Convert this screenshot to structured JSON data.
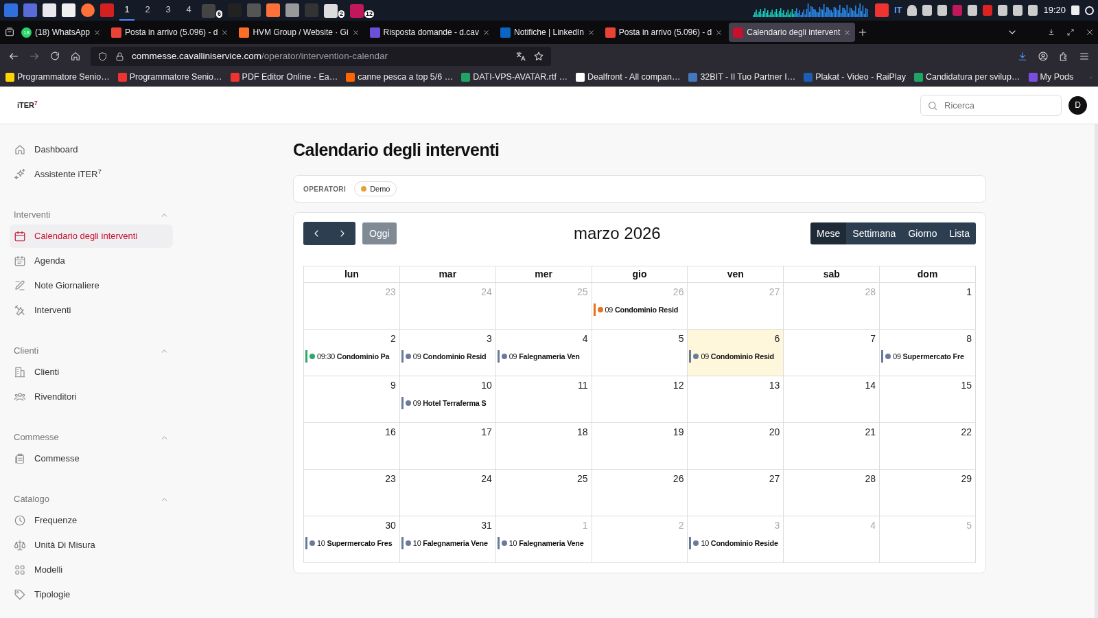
{
  "taskbar": {
    "workspaces": [
      {
        "label": "1",
        "selected": true
      },
      {
        "label": "2",
        "selected": false
      },
      {
        "label": "3",
        "selected": false
      },
      {
        "label": "4",
        "selected": false
      }
    ],
    "app_badges": [
      "6",
      "2",
      "12"
    ],
    "keyboard_layout": "IT",
    "clock": "19:20"
  },
  "browser": {
    "tabs": [
      {
        "title": "(18) WhatsApp",
        "badge": "18",
        "selected": false
      },
      {
        "title": "Posta in arrivo (5.096) - d",
        "selected": false
      },
      {
        "title": "HVM Group / Website · Gi",
        "selected": false
      },
      {
        "title": "Risposta domande - d.cav",
        "selected": false
      },
      {
        "title": "Notifiche | LinkedIn",
        "selected": false
      },
      {
        "title": "Posta in arrivo (5.096) - d",
        "selected": false
      },
      {
        "title": "Calendario degli intervent",
        "selected": true
      }
    ],
    "url_host": "commesse.cavalliniservice.com",
    "url_path": "/operator/intervention-calendar",
    "bookmarks": [
      "Programmatore Senio…",
      "Programmatore Senio…",
      "PDF Editor Online - Ea…",
      "canne pesca a top 5/6 …",
      "DATI-VPS-AVATAR.rtf …",
      "Dealfront - All compan…",
      "32BIT - Il Tuo Partner I…",
      "Plakat - Video - RaiPlay",
      "Candidatura per svilup…",
      "My Pods"
    ]
  },
  "app": {
    "logo": "iTER",
    "logo_sup": "7",
    "search": {
      "placeholder": "Ricerca"
    },
    "avatar": "D"
  },
  "sidebar": {
    "top_items": [
      {
        "label": "Dashboard",
        "selected": false
      },
      {
        "label": "Assistente iTER$^{7}$",
        "selected": false
      }
    ],
    "sections": [
      {
        "title": "Interventi",
        "expanded": true,
        "items": [
          {
            "label": "Calendario degli interventi",
            "selected": true
          },
          {
            "label": "Agenda",
            "selected": false
          },
          {
            "label": "Note Giornaliere",
            "selected": false
          },
          {
            "label": "Interventi",
            "selected": false
          }
        ]
      },
      {
        "title": "Clienti",
        "expanded": true,
        "items": [
          {
            "label": "Clienti",
            "selected": false
          },
          {
            "label": "Rivenditori",
            "selected": false
          }
        ]
      },
      {
        "title": "Commesse",
        "expanded": true,
        "items": [
          {
            "label": "Commesse",
            "selected": false
          }
        ]
      },
      {
        "title": "Catalogo",
        "expanded": true,
        "items": [
          {
            "label": "Frequenze",
            "selected": false
          },
          {
            "label": "Unità Di Misura",
            "selected": false
          },
          {
            "label": "Modelli",
            "selected": false
          },
          {
            "label": "Tipologie",
            "selected": false
          }
        ]
      }
    ]
  },
  "page_title": "Calendario degli interventi",
  "operators": {
    "label": "OPERATORI",
    "chips": [
      {
        "name": "Demo",
        "color": "#e5a23a"
      }
    ]
  },
  "calendar": {
    "today_button": "Oggi",
    "title": "marzo 2026",
    "views": [
      {
        "label": "Mese",
        "selected": true
      },
      {
        "label": "Settimana",
        "selected": false
      },
      {
        "label": "Giorno",
        "selected": false
      },
      {
        "label": "Lista",
        "selected": false
      }
    ],
    "weekdays": [
      "lun",
      "mar",
      "mer",
      "gio",
      "ven",
      "sab",
      "dom"
    ],
    "weeks": [
      [
        {
          "day": "23",
          "other_month": true,
          "today": false
        },
        {
          "day": "24",
          "other_month": true,
          "today": false
        },
        {
          "day": "25",
          "other_month": true,
          "today": false
        },
        {
          "day": "26",
          "other_month": true,
          "today": false,
          "events": [
            {
              "time": "09",
              "title": "Condominio Resid",
              "color": "#e8711c"
            }
          ]
        },
        {
          "day": "27",
          "other_month": true,
          "today": false
        },
        {
          "day": "28",
          "other_month": true,
          "today": false
        },
        {
          "day": "1",
          "other_month": false,
          "today": false
        }
      ],
      [
        {
          "day": "2",
          "other_month": false,
          "today": false,
          "events": [
            {
              "time": "09:30",
              "title": "Condominio Pa",
              "color": "#2fa86a"
            }
          ]
        },
        {
          "day": "3",
          "other_month": false,
          "today": false,
          "events": [
            {
              "time": "09",
              "title": "Condominio Resid",
              "color": "#6b7a99"
            }
          ]
        },
        {
          "day": "4",
          "other_month": false,
          "today": false,
          "events": [
            {
              "time": "09",
              "title": "Falegnameria Ven",
              "color": "#6b7a99"
            }
          ]
        },
        {
          "day": "5",
          "other_month": false,
          "today": false
        },
        {
          "day": "6",
          "other_month": false,
          "today": true,
          "events": [
            {
              "time": "09",
              "title": "Condominio Resid",
              "color": "#6b7a99"
            }
          ]
        },
        {
          "day": "7",
          "other_month": false,
          "today": false
        },
        {
          "day": "8",
          "other_month": false,
          "today": false,
          "events": [
            {
              "time": "09",
              "title": "Supermercato Fre",
              "color": "#6b7a99"
            }
          ]
        }
      ],
      [
        {
          "day": "9",
          "other_month": false,
          "today": false
        },
        {
          "day": "10",
          "other_month": false,
          "today": false,
          "events": [
            {
              "time": "09",
              "title": "Hotel Terraferma S",
              "color": "#6b7a99"
            }
          ]
        },
        {
          "day": "11",
          "other_month": false,
          "today": false
        },
        {
          "day": "12",
          "other_month": false,
          "today": false
        },
        {
          "day": "13",
          "other_month": false,
          "today": false
        },
        {
          "day": "14",
          "other_month": false,
          "today": false
        },
        {
          "day": "15",
          "other_month": false,
          "today": false
        }
      ],
      [
        {
          "day": "16",
          "other_month": false,
          "today": false
        },
        {
          "day": "17",
          "other_month": false,
          "today": false
        },
        {
          "day": "18",
          "other_month": false,
          "today": false
        },
        {
          "day": "19",
          "other_month": false,
          "today": false
        },
        {
          "day": "20",
          "other_month": false,
          "today": false
        },
        {
          "day": "21",
          "other_month": false,
          "today": false
        },
        {
          "day": "22",
          "other_month": false,
          "today": false
        }
      ],
      [
        {
          "day": "23",
          "other_month": false,
          "today": false
        },
        {
          "day": "24",
          "other_month": false,
          "today": false
        },
        {
          "day": "25",
          "other_month": false,
          "today": false
        },
        {
          "day": "26",
          "other_month": false,
          "today": false
        },
        {
          "day": "27",
          "other_month": false,
          "today": false
        },
        {
          "day": "28",
          "other_month": false,
          "today": false
        },
        {
          "day": "29",
          "other_month": false,
          "today": false
        }
      ],
      [
        {
          "day": "30",
          "other_month": false,
          "today": false,
          "events": [
            {
              "time": "10",
              "title": "Supermercato Fres",
              "color": "#6b7a99"
            }
          ]
        },
        {
          "day": "31",
          "other_month": false,
          "today": false,
          "events": [
            {
              "time": "10",
              "title": "Falegnameria Vene",
              "color": "#6b7a99"
            }
          ]
        },
        {
          "day": "1",
          "other_month": true,
          "today": false,
          "events": [
            {
              "time": "10",
              "title": "Falegnameria Vene",
              "color": "#6b7a99"
            }
          ]
        },
        {
          "day": "2",
          "other_month": true,
          "today": false
        },
        {
          "day": "3",
          "other_month": true,
          "today": false,
          "events": [
            {
              "time": "10",
              "title": "Condominio Reside",
              "color": "#6b7a99"
            }
          ]
        },
        {
          "day": "4",
          "other_month": true,
          "today": false
        },
        {
          "day": "5",
          "other_month": true,
          "today": false
        }
      ]
    ]
  }
}
